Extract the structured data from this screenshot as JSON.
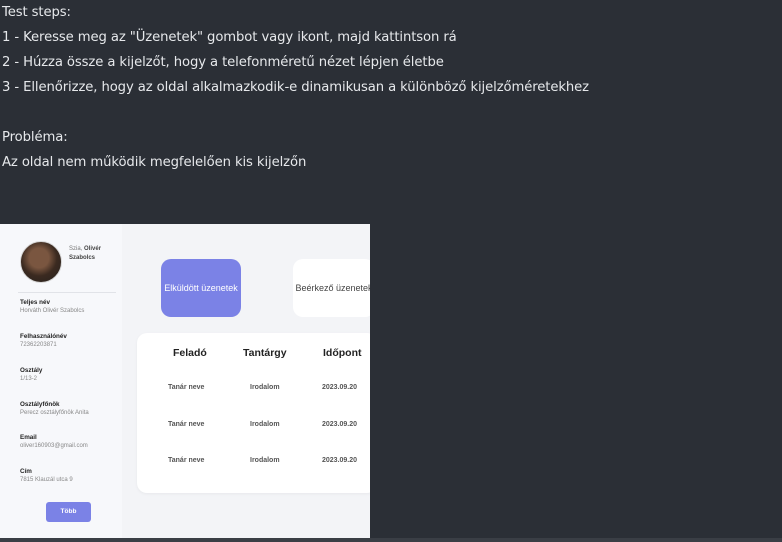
{
  "test_steps": {
    "heading": "Test steps:",
    "steps": [
      "1 - Keresse meg az \"Üzenetek\" gombot vagy ikont, majd kattintson rá",
      "2 - Húzza össze a kijelzőt, hogy a telefonméretű nézet lépjen életbe",
      "3 - Ellenőrizze, hogy az oldal alkalmazkodik-e dinamikusan a különböző kijelzőméretekhez"
    ]
  },
  "problem": {
    "heading": "Probléma:",
    "text": "Az oldal nem működik megfelelően kis kijelzőn"
  },
  "screenshot": {
    "greeting_prefix": "Szia, ",
    "greeting_name": "Olivér Szabolcs",
    "fields": [
      {
        "label": "Teljes név",
        "value": "Horváth Olivér Szabolcs"
      },
      {
        "label": "Felhasználónév",
        "value": "72362203871"
      },
      {
        "label": "Osztály",
        "value": "1/13-2"
      },
      {
        "label": "Osztályfőnök",
        "value": "Perecz osztályfőnök Anita"
      },
      {
        "label": "Email",
        "value": "oliver160903@gmail.com"
      },
      {
        "label": "Cím",
        "value": "7815 Klauzál utca 9"
      }
    ],
    "more_button": "Több",
    "tabs": {
      "sent": "Elküldött üzenetek",
      "inbox": "Beérkező üzenetek"
    },
    "table": {
      "headers": [
        "Feladó",
        "Tantárgy",
        "Időpont"
      ],
      "rows": [
        [
          "Tanár neve",
          "Irodalom",
          "2023.09.20"
        ],
        [
          "Tanár neve",
          "Irodalom",
          "2023.09.20"
        ],
        [
          "Tanár neve",
          "Irodalom",
          "2023.09.20"
        ]
      ]
    }
  }
}
